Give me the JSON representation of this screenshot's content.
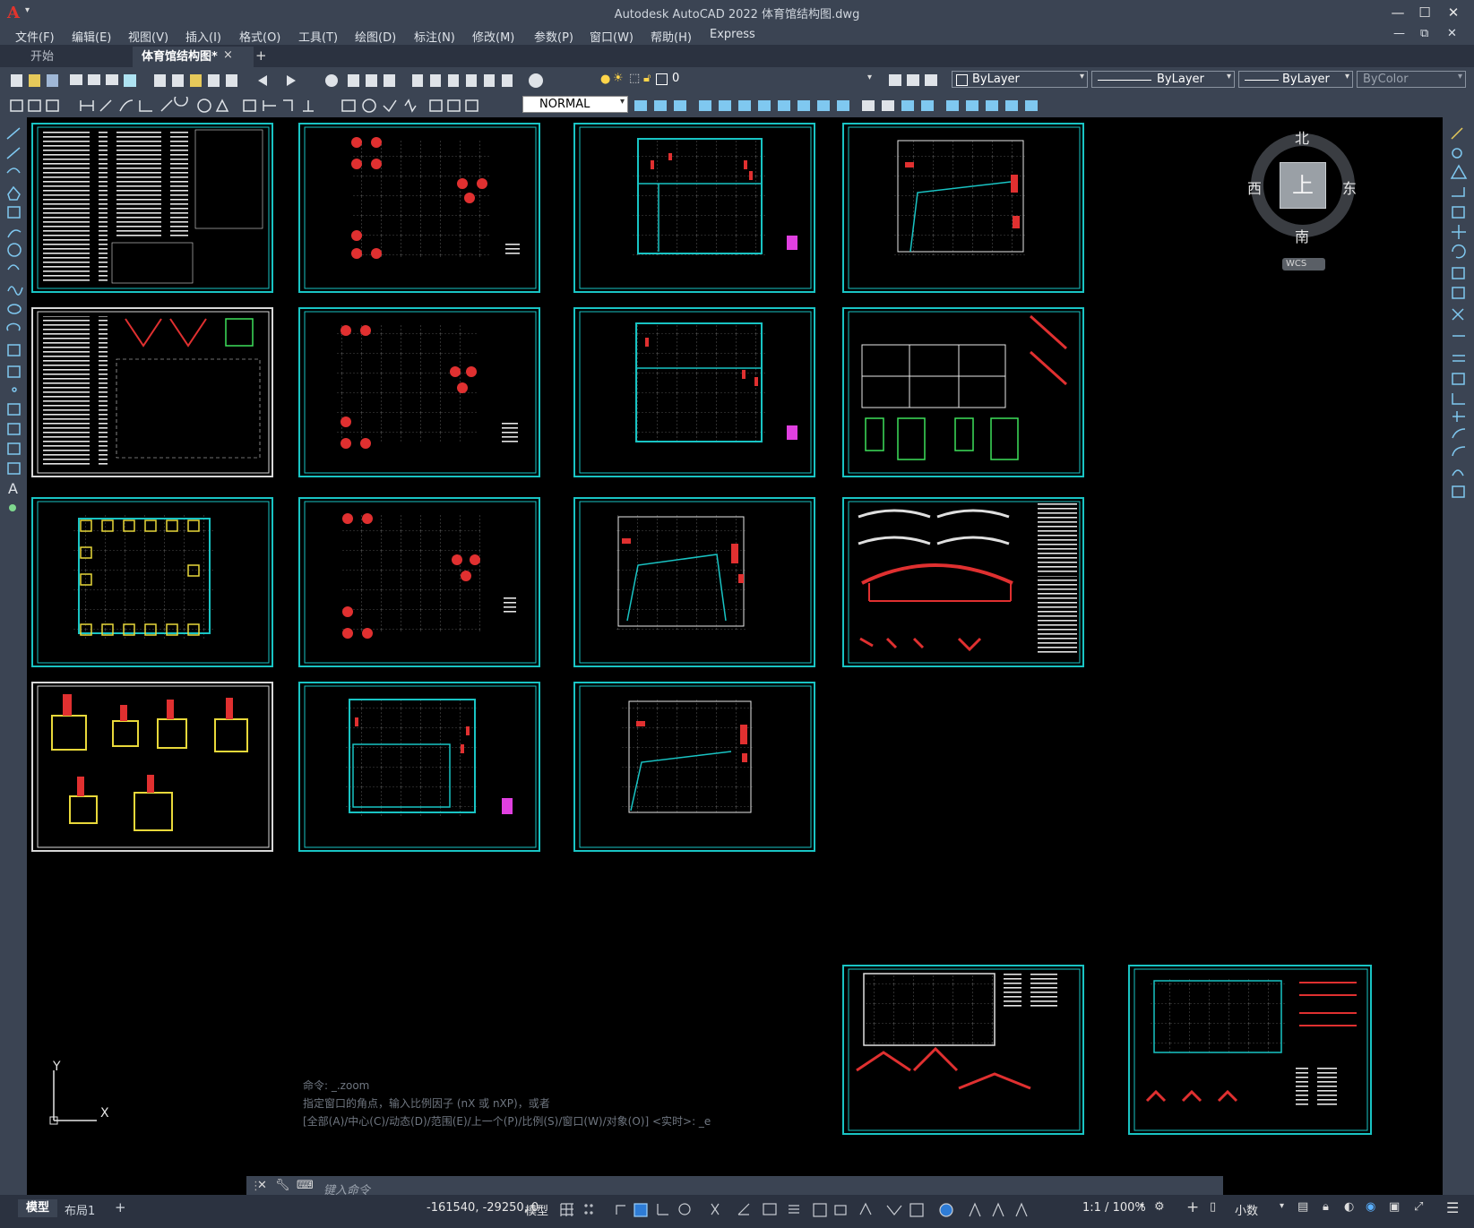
{
  "app": {
    "title": "Autodesk AutoCAD 2022    体育馆结构图.dwg",
    "logo": "A"
  },
  "menu": [
    "文件(F)",
    "编辑(E)",
    "视图(V)",
    "插入(I)",
    "格式(O)",
    "工具(T)",
    "绘图(D)",
    "标注(N)",
    "修改(M)",
    "参数(P)",
    "窗口(W)",
    "帮助(H)",
    "Express"
  ],
  "tabs": {
    "start": "开始",
    "doc": "体育馆结构图*",
    "close": "×",
    "add": "+"
  },
  "toolbar": {
    "layer": "0",
    "color": "ByLayer",
    "linetype": "ByLayer",
    "lineweight": "ByLayer",
    "plotstyle": "ByColor",
    "textstyle": "NORMAL"
  },
  "viewcube": {
    "north": "北",
    "south": "南",
    "east": "东",
    "west": "西",
    "face": "上",
    "wcs": "WCS"
  },
  "ucs": {
    "y": "Y",
    "x": "X"
  },
  "command": {
    "history": [
      "命令: _.zoom",
      "指定窗口的角点，输入比例因子 (nX 或 nXP)，或者",
      "[全部(A)/中心(C)/动态(D)/范围(E)/上一个(P)/比例(S)/窗口(W)/对象(O)] <实时>: _e"
    ],
    "placeholder": "键入命令"
  },
  "layout_tabs": {
    "model": "模型",
    "layout1": "布局1",
    "add": "+"
  },
  "status": {
    "coords": "-161540, -29250, 0",
    "space": "模型",
    "scale": "1:1 / 100%",
    "units": "小数"
  },
  "colors": {
    "accent": "#19c4c4",
    "chrome": "#3b4453",
    "chrome_dark": "#2b3240"
  }
}
